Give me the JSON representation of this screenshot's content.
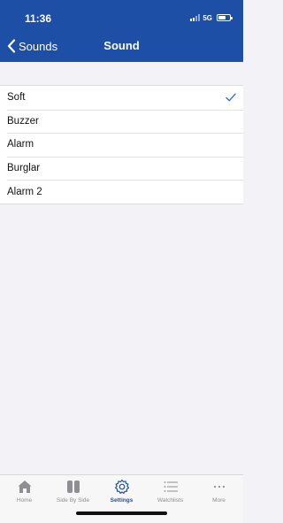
{
  "status_bar": {
    "time": "11:36",
    "network": "5G",
    "icons": [
      "signal-icon",
      "battery-icon"
    ]
  },
  "nav": {
    "back_label": "Sounds",
    "title": "Sound",
    "back_icon": "chevron-left-icon"
  },
  "sounds": {
    "items": [
      {
        "label": "Soft",
        "selected": true
      },
      {
        "label": "Buzzer",
        "selected": false
      },
      {
        "label": "Alarm",
        "selected": false
      },
      {
        "label": "Burglar",
        "selected": false
      },
      {
        "label": "Alarm 2",
        "selected": false
      }
    ],
    "selected_icon": "checkmark-icon"
  },
  "tab_bar": {
    "tabs": [
      {
        "label": "Home",
        "icon": "home-icon",
        "active": false
      },
      {
        "label": "Side By Side",
        "icon": "side-by-side-icon",
        "active": false
      },
      {
        "label": "Settings",
        "icon": "gear-icon",
        "active": true
      },
      {
        "label": "Watchlists",
        "icon": "list-icon",
        "active": false
      },
      {
        "label": "More",
        "icon": "more-dots-icon",
        "active": false
      }
    ]
  },
  "colors": {
    "header_bg": "#1e4fa6",
    "accent": "#2f6fd6",
    "inactive_tab": "#8e8e93"
  }
}
